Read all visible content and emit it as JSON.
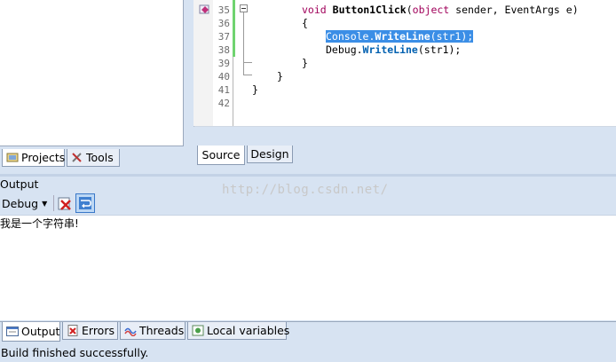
{
  "left_panel": {
    "tabs": [
      {
        "label": "Projects",
        "icon": "projects-icon",
        "selected": true
      },
      {
        "label": "Tools",
        "icon": "tools-icon",
        "selected": false
      }
    ]
  },
  "editor": {
    "lines": [
      {
        "num": "35",
        "text": "void Button1Click(object sender, EventArgs e)"
      },
      {
        "num": "36",
        "text": "{"
      },
      {
        "num": "37",
        "text": "Console.WriteLine(str1);"
      },
      {
        "num": "38",
        "text": "Debug.WriteLine(str1);"
      },
      {
        "num": "39",
        "text": "}"
      },
      {
        "num": "40",
        "text": "}"
      },
      {
        "num": "41",
        "text": "}"
      },
      {
        "num": "42",
        "text": ""
      }
    ],
    "tabs": [
      {
        "label": "Source",
        "selected": true
      },
      {
        "label": "Design",
        "selected": false
      }
    ]
  },
  "output": {
    "title": "Output",
    "watermark": "http://blog.csdn.net/",
    "source_selector": "Debug",
    "text": "我是一个字符串!"
  },
  "bottom_tabs": [
    {
      "label": "Output",
      "icon": "output-icon",
      "selected": true
    },
    {
      "label": "Errors",
      "icon": "errors-icon",
      "selected": false
    },
    {
      "label": "Threads",
      "icon": "threads-icon",
      "selected": false
    },
    {
      "label": "Local variables",
      "icon": "local-variables-icon",
      "selected": false
    }
  ],
  "status": {
    "text": "Build finished successfully."
  },
  "colors": {
    "chrome": "#d7e3f2",
    "selection": "#3b8ee6",
    "keyword": "#a0005a",
    "method": "#0060b0",
    "changed_line_bar": "#6fd36f"
  }
}
